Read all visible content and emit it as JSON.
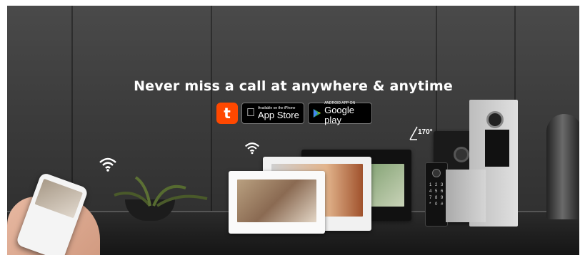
{
  "headline": "Never miss a call at anywhere & anytime",
  "badges": {
    "tuya_label": "t",
    "appstore_small": "Available on the iPhone",
    "appstore_big": "App Store",
    "gplay_small": "ANDROID APP ON",
    "gplay_big": "Google play"
  },
  "angle_label": "170°",
  "keypad_labels": [
    "1",
    "2",
    "3",
    "4",
    "5",
    "6",
    "7",
    "8",
    "9",
    "*",
    "0",
    "#"
  ],
  "colors": {
    "tuya": "#ff4800",
    "background": "#3b3b3b"
  },
  "icons": [
    "wifi-icon",
    "apple-icon",
    "google-play-icon",
    "tuya-icon"
  ]
}
